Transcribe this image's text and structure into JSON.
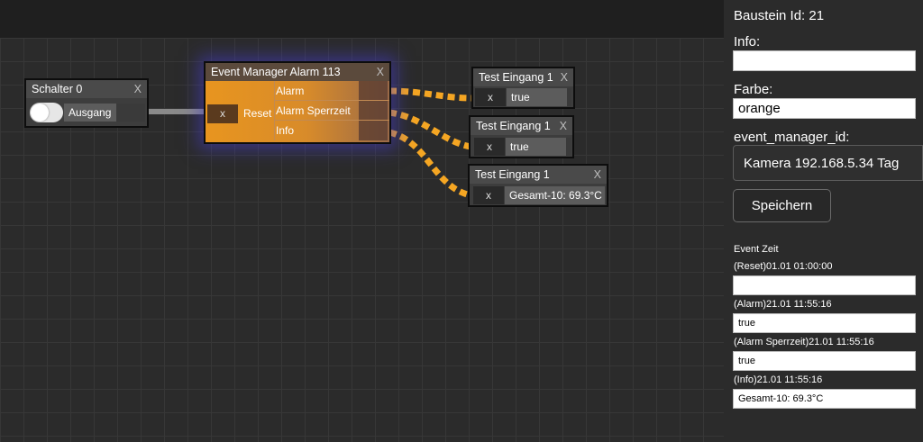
{
  "nodes": {
    "schalter": {
      "title": "Schalter 0",
      "close": "X",
      "output_label": "Ausgang"
    },
    "event_manager": {
      "title": "Event Manager Alarm 113",
      "close": "X",
      "input_x": "x",
      "input_label": "Reset",
      "outputs": [
        "Alarm",
        "Alarm Sperrzeit",
        "Info"
      ]
    },
    "test1": {
      "title": "Test Eingang 1",
      "close": "X",
      "input_x": "x",
      "value": "true"
    },
    "test2": {
      "title": "Test Eingang 1",
      "close": "X",
      "input_x": "x",
      "value": "true"
    },
    "test3": {
      "title": "Test Eingang 1",
      "close": "X",
      "input_x": "x",
      "value": "Gesamt-10: 69.3°C"
    }
  },
  "panel": {
    "baustein": "Baustein Id: 21",
    "info_label": "Info:",
    "info_value": "",
    "farbe_label": "Farbe:",
    "farbe_value": "orange",
    "event_manager_label": "event_manager_id:",
    "event_manager_value": "Kamera 192.168.5.34 Tag",
    "save_label": "Speichern",
    "event_zeit_label": "Event Zeit",
    "events": [
      {
        "label": "(Reset)01.01 01:00:00",
        "value": ""
      },
      {
        "label": "(Alarm)21.01 11:55:16",
        "value": "true"
      },
      {
        "label": "(Alarm Sperrzeit)21.01 11:55:16",
        "value": "true"
      },
      {
        "label": "(Info)21.01 11:55:16",
        "value": "Gesamt-10: 69.3°C"
      }
    ]
  },
  "colors": {
    "wire_active": "#f5a623",
    "node_orange": "#e8951f",
    "wire_idle": "#8a8a8a"
  },
  "icons": {
    "toggle": "toggle-switch-icon"
  }
}
